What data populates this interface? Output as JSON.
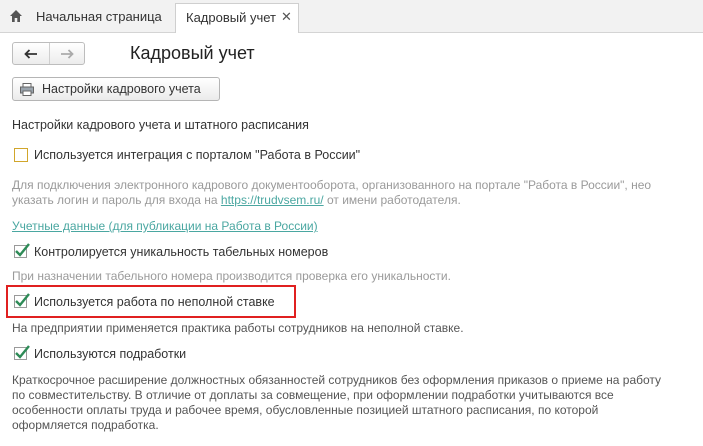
{
  "tabs": {
    "home_label": "Начальная страница",
    "active_label": "Кадровый учет",
    "close_glyph": "✕"
  },
  "nav": {
    "back_glyph": "←",
    "forward_glyph": "→"
  },
  "page": {
    "title": "Кадровый учет"
  },
  "toolbar": {
    "settings_button_label": "Настройки кадрового учета"
  },
  "section": {
    "heading": "Настройки кадрового учета и штатного расписания"
  },
  "options": [
    {
      "label": "Используется интеграция с порталом \"Работа в России\"",
      "checked": false,
      "hint_lines": [
        "Для подключения электронного кадрового документооборота, организованного на портале \"Работа в России\", нео",
        "указать логин и пароль для входа на "
      ],
      "hint_link": "https://trudvsem.ru/",
      "hint_after_link": " от имени работодателя.",
      "extra_link": "Учетные данные (для публикации на Работа в России)"
    },
    {
      "label": "Контролируется уникальность табельных номеров",
      "checked": true,
      "hint_lines": [
        "При назначении табельного номера производится проверка его уникальности."
      ]
    },
    {
      "label": "Используется работа по неполной ставке",
      "checked": true,
      "hint_lines": [
        "На предприятии применяется практика работы сотрудников на неполной ставке."
      ]
    },
    {
      "label": "Используются подработки",
      "checked": true,
      "hint_lines": [
        "Краткосрочное расширение должностных обязанностей сотрудников без оформления приказов о приеме на работу",
        "по совместительству. В отличие от доплаты за совмещение, при оформлении подработки учитываются все",
        "особенности оплаты труда и рабочее время, обусловленные позицией штатного расписания, по которой",
        "оформляется подработка."
      ]
    }
  ],
  "colors": {
    "check": "#2e8b57",
    "highlight": "#e02020",
    "link": "#4aa7a1",
    "focus": "#d1a62b"
  }
}
